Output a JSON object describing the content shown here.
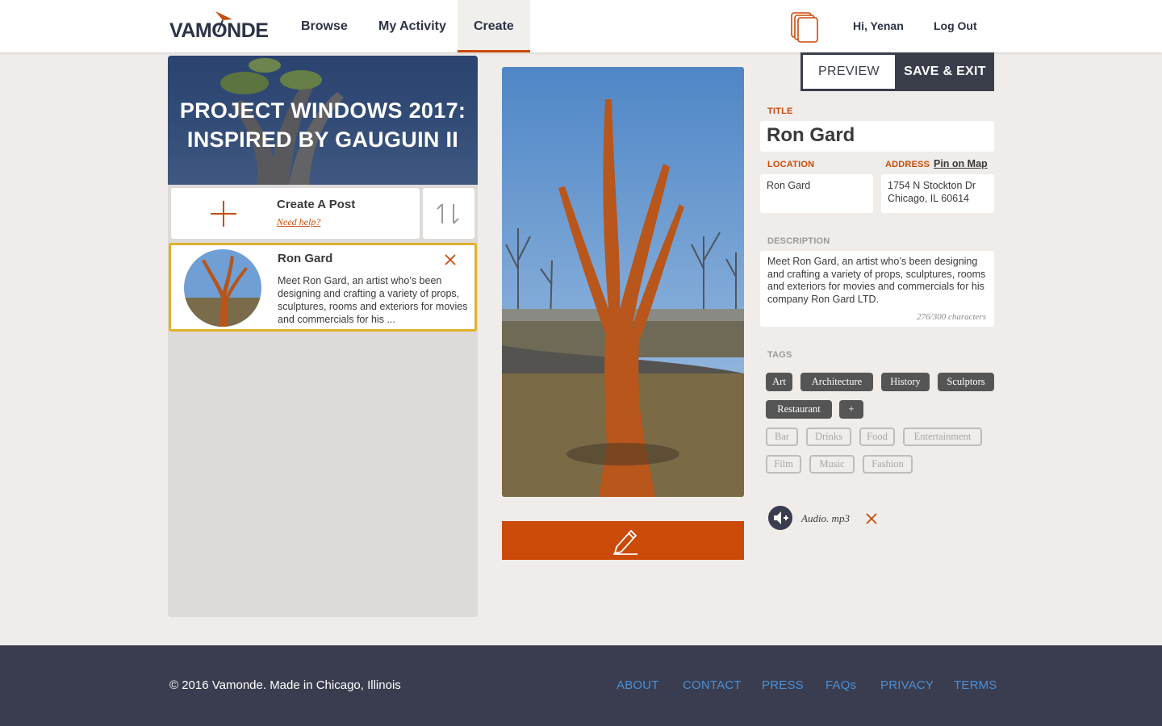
{
  "header": {
    "logo": "VAMONDE",
    "nav": [
      "Browse",
      "My Activity",
      "Create"
    ],
    "greeting": "Hi, Yenan",
    "logout": "Log Out"
  },
  "left": {
    "hero_title": "PROJECT WINDOWS 2017: INSPIRED BY GAUGUIN II",
    "create_label": "Create A Post",
    "need_help": "Need help?",
    "post": {
      "title": "Ron Gard",
      "excerpt": "Meet Ron Gard, an artist who’s been designing and crafting a variety of props, sculptures, rooms and exteriors for movies and commercials for his ..."
    }
  },
  "toolbar": {
    "preview": "PREVIEW",
    "save_exit": "SAVE & EXIT"
  },
  "form": {
    "title_label": "TITLE",
    "title_value": "Ron Gard",
    "location_label": "LOCATION",
    "location_value": "Ron Gard",
    "address_label": "ADDRESS",
    "pin_on_map": "Pin on Map",
    "address_line1": "1754 N Stockton Dr",
    "address_line2": "Chicago, IL 60614",
    "description_label": "DESCRIPTION",
    "description_value": "Meet Ron Gard, an artist who’s been designing and crafting a variety of props, sculptures, rooms and exteriors for movies and commercials for his company Ron Gard LTD.",
    "char_count": "276/300 characters",
    "tags_label": "TAGS",
    "selected_tags": [
      "Art",
      "Architecture",
      "History",
      "Sculptors",
      "Restaurant"
    ],
    "add_tag": "+",
    "suggested_tags": [
      "Bar",
      "Drinks",
      "Food",
      "Entertainment",
      "Film",
      "Music",
      "Fashion"
    ],
    "audio_file": "Audio. mp3"
  },
  "footer": {
    "copyright": "© 2016 Vamonde. Made in Chicago, Illinois",
    "links": [
      "ABOUT",
      "CONTACT",
      "PRESS",
      "FAQs",
      "PRIVACY",
      "TERMS"
    ]
  },
  "colors": {
    "accent": "#cc4a08",
    "dark": "#3a3d4f",
    "highlight": "#e0b22d",
    "link": "#4a8fd6"
  }
}
